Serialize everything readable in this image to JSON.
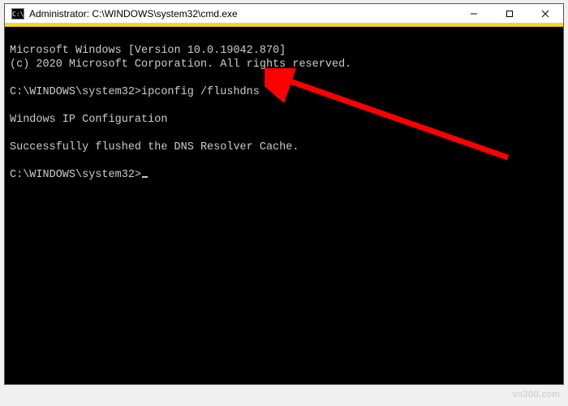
{
  "window": {
    "title": "Administrator: C:\\WINDOWS\\system32\\cmd.exe",
    "icon_label": "C:\\"
  },
  "terminal": {
    "lines": {
      "l0": "Microsoft Windows [Version 10.0.19042.870]",
      "l1": "(c) 2020 Microsoft Corporation. All rights reserved.",
      "l2": "",
      "l3_prompt": "C:\\WINDOWS\\system32>",
      "l3_cmd": "ipconfig /flushdns",
      "l4": "",
      "l5": "Windows IP Configuration",
      "l6": "",
      "l7": "Successfully flushed the DNS Resolver Cache.",
      "l8": "",
      "l9_prompt": "C:\\WINDOWS\\system32>"
    }
  },
  "annotation": {
    "arrow_color": "#ff0000"
  },
  "watermark": "vn300.com"
}
